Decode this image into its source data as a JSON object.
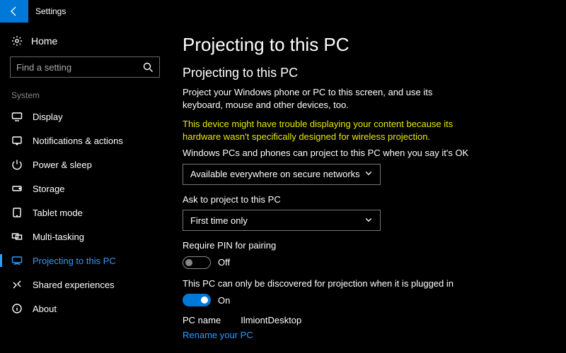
{
  "titlebar": {
    "title": "Settings"
  },
  "sidebar": {
    "home": "Home",
    "search_placeholder": "Find a setting",
    "category": "System",
    "items": [
      {
        "label": "Display"
      },
      {
        "label": "Notifications & actions"
      },
      {
        "label": "Power & sleep"
      },
      {
        "label": "Storage"
      },
      {
        "label": "Tablet mode"
      },
      {
        "label": "Multi-tasking"
      },
      {
        "label": "Projecting to this PC"
      },
      {
        "label": "Shared experiences"
      },
      {
        "label": "About"
      }
    ]
  },
  "main": {
    "page_title": "Projecting to this PC",
    "section_title": "Projecting to this PC",
    "description": "Project your Windows phone or PC to this screen, and use its keyboard, mouse and other devices, too.",
    "warning": "This device might have trouble displaying your content because its hardware wasn't specifically designed for wireless projection.",
    "availability_label": "Windows PCs and phones can project to this PC when you say it's OK",
    "availability_value": "Available everywhere on secure networks",
    "ask_label": "Ask to project to this PC",
    "ask_value": "First time only",
    "pin_label": "Require PIN for pairing",
    "pin_state": "Off",
    "discover_label": "This PC can only be discovered for projection when it is plugged in",
    "discover_state": "On",
    "pcname_label": "PC name",
    "pcname_value": "IlmiontDesktop",
    "rename_link": "Rename your PC"
  }
}
